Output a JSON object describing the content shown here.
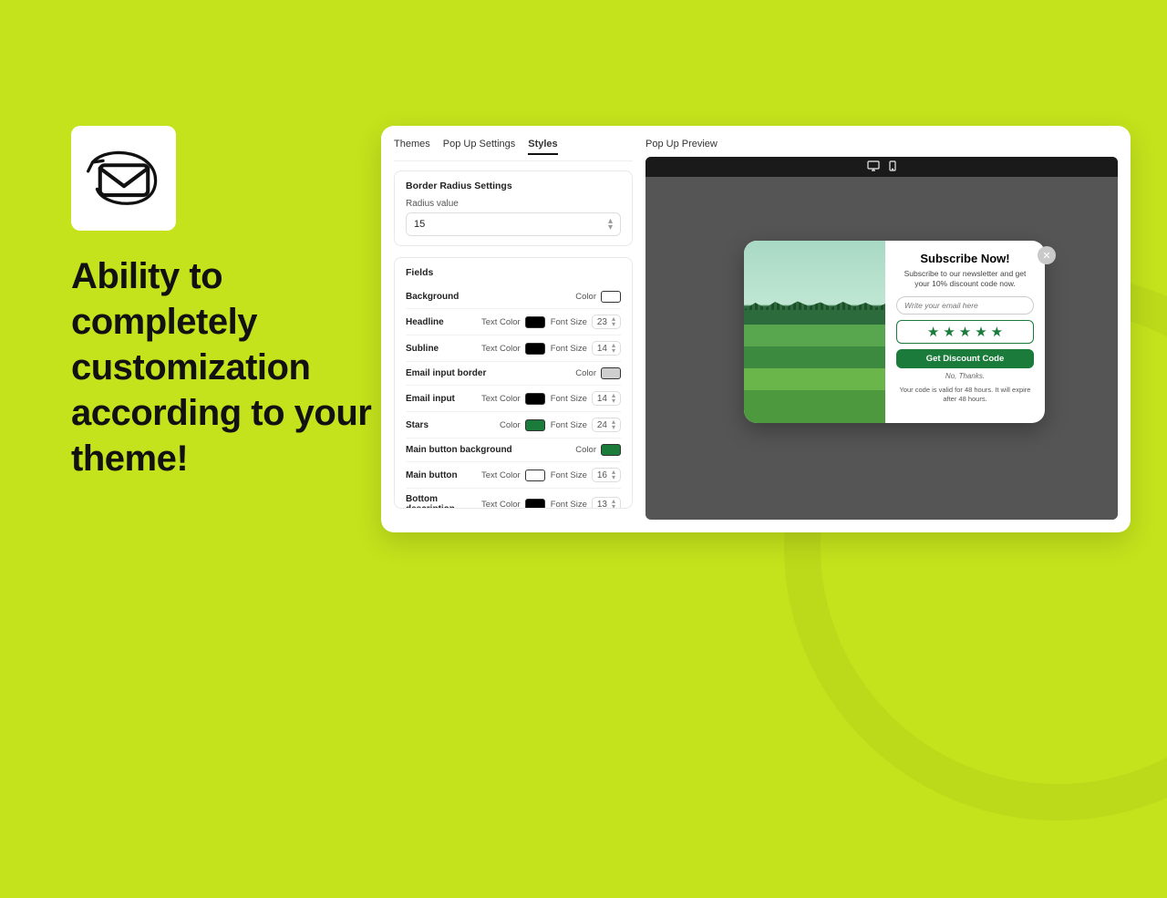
{
  "hero": "Ability to completely customization according to your theme!",
  "tabs": {
    "themes": "Themes",
    "popup_settings": "Pop Up Settings",
    "styles": "Styles"
  },
  "border_radius": {
    "title": "Border Radius Settings",
    "label": "Radius value",
    "value": "15"
  },
  "fields_title": "Fields",
  "labels": {
    "color": "Color",
    "text_color": "Text Color",
    "font_size": "Font Size"
  },
  "rows": {
    "background": {
      "name": "Background",
      "color": "#ffffff"
    },
    "headline": {
      "name": "Headline",
      "text_color": "#000000",
      "font_size": "23"
    },
    "subline": {
      "name": "Subline",
      "text_color": "#000000",
      "font_size": "14"
    },
    "email_border": {
      "name": "Email input border",
      "color": "#cfcfcf"
    },
    "email_input": {
      "name": "Email input",
      "text_color": "#000000",
      "font_size": "14"
    },
    "stars": {
      "name": "Stars",
      "color": "#1a7b3a",
      "font_size": "24"
    },
    "main_button_bg": {
      "name": "Main button background",
      "color": "#1a7b3a"
    },
    "main_button": {
      "name": "Main button",
      "text_color": "#ffffff",
      "font_size": "16"
    },
    "bottom_desc": {
      "name": "Bottom description",
      "text_color": "#000000",
      "font_size": "13"
    }
  },
  "preview": {
    "title": "Pop Up Preview",
    "headline": "Subscribe Now!",
    "subline": "Subscribe to our newsletter and get your 10% discount code now.",
    "email_placeholder": "Write your email here",
    "cta": "Get Discount Code",
    "decline": "No, Thanks.",
    "fineprint": "Your code is valid for 48 hours. It will expire after 48 hours."
  }
}
